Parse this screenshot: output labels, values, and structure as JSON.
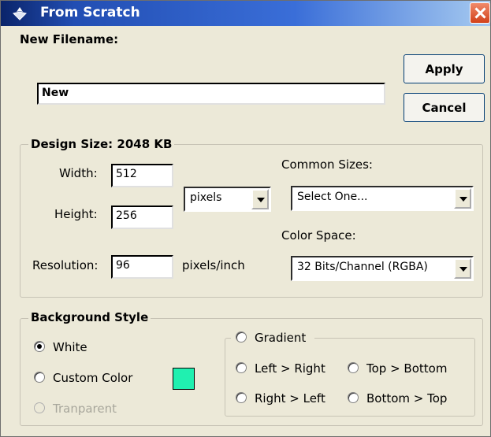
{
  "window": {
    "title": "From Scratch",
    "icon": "app-icon",
    "close_icon": "close-icon"
  },
  "filename": {
    "label": "New Filename:",
    "value": "New"
  },
  "buttons": {
    "apply": "Apply",
    "cancel": "Cancel"
  },
  "design": {
    "title": "Design Size: 2048 KB",
    "width_label": "Width:",
    "width_value": "512",
    "height_label": "Height:",
    "height_value": "256",
    "resolution_label": "Resolution:",
    "resolution_value": "96",
    "resolution_unit": "pixels/inch",
    "unit_select": "pixels",
    "common_sizes_label": "Common Sizes:",
    "common_sizes_value": "Select One...",
    "color_space_label": "Color Space:",
    "color_space_value": "32 Bits/Channel (RGBA)"
  },
  "background": {
    "title": "Background Style",
    "white": "White",
    "custom_color": "Custom Color",
    "custom_color_swatch": "#20f0b0",
    "transparent": "Tranparent",
    "gradient": "Gradient",
    "left_right": "Left > Right",
    "top_bottom": "Top > Bottom",
    "right_left": "Right > Left",
    "bottom_top": "Bottom > Top",
    "selected": "White"
  }
}
